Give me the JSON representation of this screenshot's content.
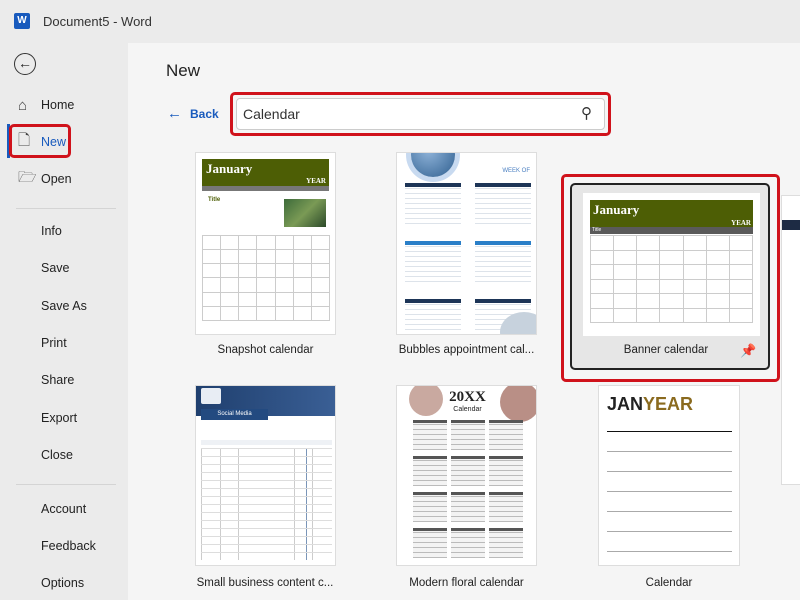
{
  "window": {
    "app_icon": "word-logo",
    "app_letter": "W",
    "title": "Document5  -  Word"
  },
  "sidebar": {
    "back_icon": "back-arrow-circle-icon",
    "items": [
      {
        "label": "Home",
        "icon": "home-icon"
      },
      {
        "label": "New",
        "icon": "new-document-icon",
        "active": true
      },
      {
        "label": "Open",
        "icon": "folder-open-icon"
      },
      {
        "label": "Info"
      },
      {
        "label": "Save"
      },
      {
        "label": "Save As"
      },
      {
        "label": "Print"
      },
      {
        "label": "Share"
      },
      {
        "label": "Export"
      },
      {
        "label": "Close"
      },
      {
        "label": "Account"
      },
      {
        "label": "Feedback"
      },
      {
        "label": "Options"
      }
    ]
  },
  "main": {
    "title": "New",
    "back_label": "Back",
    "search": {
      "value": "Calendar",
      "icon": "search-icon"
    },
    "templates": [
      {
        "label": "Snapshot calendar",
        "month": "January",
        "year": "YEAR",
        "title": "Title"
      },
      {
        "label": "Bubbles appointment cal...",
        "heading": "WEEK OF"
      },
      {
        "label": "Banner calendar",
        "month": "January",
        "year": "YEAR",
        "title": "Title",
        "selected": true,
        "pin_icon": "pin-icon"
      },
      {
        "label": "Small business content c...",
        "section": "Social Media"
      },
      {
        "label": "Modern floral calendar",
        "year": "20XX",
        "subtitle": "Calendar"
      },
      {
        "label": "Calendar",
        "month": "JAN",
        "year": "YEAR"
      }
    ]
  },
  "colors": {
    "accent": "#185abd",
    "highlight": "#d0121b",
    "banner": "#4d5e05",
    "janyear_gold": "#8a6a1e"
  }
}
